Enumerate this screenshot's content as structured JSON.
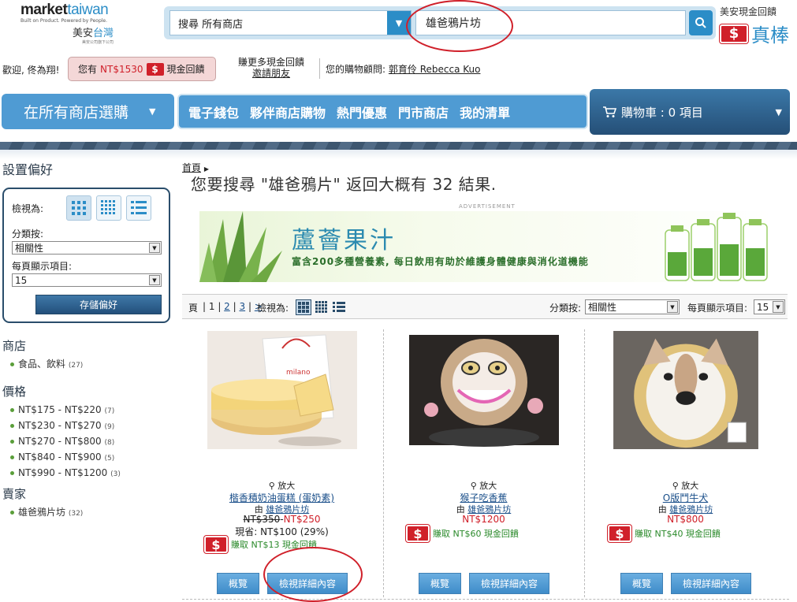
{
  "header": {
    "logo_en": "market",
    "logo_en_accent": "taiwan",
    "logo_tagline": "Built on Product. Powered by People.",
    "logo_cn": "美安",
    "logo_cn_accent": "台灣",
    "logo_sub": "美安公司旗下公司",
    "store_scope": "搜尋 所有商店",
    "search_value": "雄爸鴉片坊",
    "cashback_title": "美安現金回饋",
    "cashback_badge": "$",
    "cashback_word": "真棒"
  },
  "userbar": {
    "welcome": "歡迎, 佟為翔!",
    "balance_prefix": "您有",
    "balance_amount": "NT$1530",
    "balance_badge": "$",
    "balance_suffix": "現金回饋",
    "invite_line1": "賺更多現金回饋",
    "invite_line2": "邀請朋友",
    "advisor_label": "您的購物顧問:",
    "advisor_name": "郭育伶 Rebecca Kuo"
  },
  "nav": {
    "all_stores": "在所有商店選購",
    "all_stores_arrow": "▼",
    "items": [
      "電子錢包",
      "夥伴商店購物",
      "熱門優惠",
      "門市商店",
      "我的清單"
    ],
    "cart": "購物車 : 0 項目",
    "cart_arrow": "▼"
  },
  "sidebar": {
    "title": "設置偏好",
    "view_label": "檢視為:",
    "sort_label": "分類按:",
    "sort_value": "相關性",
    "per_page_label": "每頁顯示項目:",
    "per_page_value": "15",
    "save_button": "存儲偏好",
    "stores_heading": "商店",
    "stores": [
      {
        "label": "食品、飲料",
        "count": "(27)"
      }
    ],
    "price_heading": "價格",
    "prices": [
      {
        "label": "NT$175 - NT$220",
        "count": "(7)"
      },
      {
        "label": "NT$230 - NT$270",
        "count": "(9)"
      },
      {
        "label": "NT$270 - NT$800",
        "count": "(8)"
      },
      {
        "label": "NT$840 - NT$900",
        "count": "(5)"
      },
      {
        "label": "NT$990 - NT$1200",
        "count": "(3)"
      }
    ],
    "seller_heading": "賣家",
    "sellers": [
      {
        "label": "雄爸鴉片坊",
        "count": "(32)"
      }
    ]
  },
  "main": {
    "breadcrumb": "首頁",
    "result_prefix": "您要搜尋 \"雄爸鴉片\" 返回大概有",
    "result_count": "32",
    "result_suffix": "結果.",
    "ad_label": "ADVERTISEMENT",
    "banner_title": "蘆薈果汁",
    "banner_subtitle": "富含200多種營養素, 每日飲用有助於維護身體健康與消化道機能",
    "pager_label": "頁",
    "pages": [
      "1",
      "2",
      "3",
      ">"
    ],
    "view_label": "檢視為:",
    "sort_label": "分類按:",
    "sort_value": "相關性",
    "per_page_label": "每頁顯示項目:",
    "per_page_value": "15"
  },
  "products": [
    {
      "zoom": "放大",
      "name": "楷香積奶油蛋糕 (蛋奶素)",
      "seller_prefix": "由",
      "seller": "雄爸鴉片坊",
      "old_price": "NT$350",
      "price": "NT$250",
      "savings": "現省: NT$100 (29%)",
      "earn": "賺取 NT$13 現金回饋",
      "overview": "概覽",
      "details": "檢視詳細內容"
    },
    {
      "zoom": "放大",
      "name": "猴子吃香蕉",
      "seller_prefix": "由",
      "seller": "雄爸鴉片坊",
      "old_price": "",
      "price": "NT$1200",
      "savings": "",
      "earn": "賺取 NT$60 現金回饋",
      "overview": "概覽",
      "details": "檢視詳細內容"
    },
    {
      "zoom": "放大",
      "name": "O版鬥牛犬",
      "seller_prefix": "由",
      "seller": "雄爸鴉片坊",
      "old_price": "",
      "price": "NT$800",
      "savings": "",
      "earn": "賺取 NT$40 現金回饋",
      "overview": "概覽",
      "details": "檢視詳細內容"
    }
  ],
  "colors": {
    "accent": "#2b8dc7",
    "nav": "#4f9bd3",
    "cart": "#254f77",
    "cashback_red": "#d0202a",
    "earn_green": "#2b8a2b"
  }
}
